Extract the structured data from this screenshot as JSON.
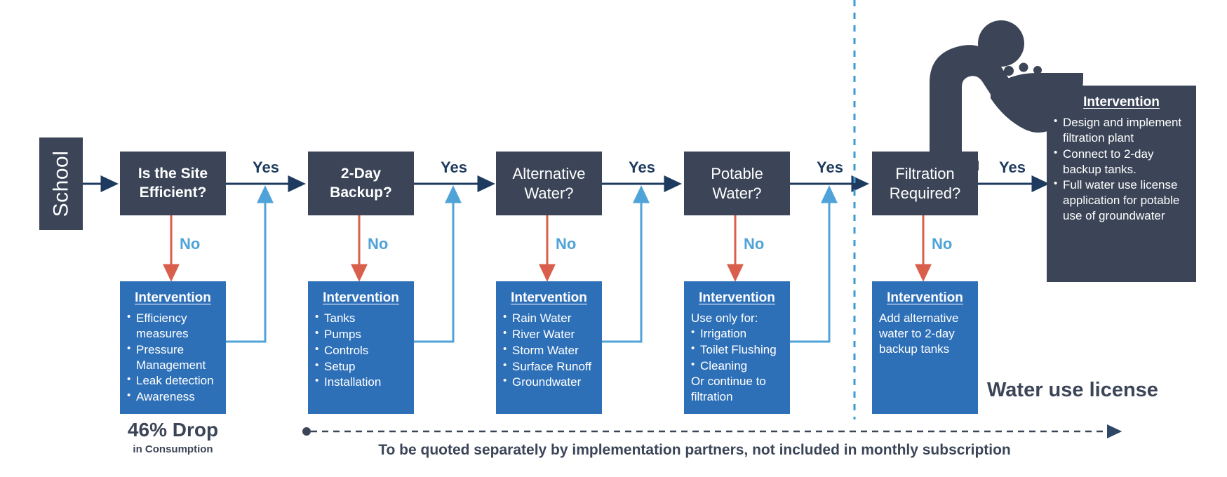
{
  "colors": {
    "dark": "#3B4557",
    "blue": "#2E70B8",
    "light_blue": "#4FA3D9",
    "red": "#D95F4C",
    "navy": "#1E3A5F",
    "white": "#FFFFFF"
  },
  "start": {
    "label": "School"
  },
  "labels": {
    "yes": "Yes",
    "no": "No",
    "intervention": "Intervention"
  },
  "decisions": [
    {
      "id": "site-efficient",
      "line1": "Is the Site",
      "line2": "Efficient?",
      "bold": true
    },
    {
      "id": "two-day-backup",
      "line1": "2-Day",
      "line2": "Backup?",
      "bold": true
    },
    {
      "id": "alternative-water",
      "line1": "Alternative",
      "line2": "Water?",
      "bold": false
    },
    {
      "id": "potable-water",
      "line1": "Potable",
      "line2": "Water?",
      "bold": false
    },
    {
      "id": "filtration-required",
      "line1": "Filtration",
      "line2": "Required?",
      "bold": false
    }
  ],
  "interventions": [
    {
      "id": "efficiency",
      "title": "Intervention",
      "lead": "",
      "items": [
        "Efficiency measures",
        "Pressure Management",
        "Leak detection",
        "Awareness"
      ],
      "trail": ""
    },
    {
      "id": "backup",
      "title": "Intervention",
      "lead": "",
      "items": [
        "Tanks",
        "Pumps",
        "Controls",
        "Setup",
        "Installation"
      ],
      "trail": ""
    },
    {
      "id": "alternative",
      "title": "Intervention",
      "lead": "",
      "items": [
        "Rain Water",
        "River Water",
        "Storm Water",
        "Surface Runoff",
        "Groundwater"
      ],
      "trail": ""
    },
    {
      "id": "potable",
      "title": "Intervention",
      "lead": "Use only for:",
      "items": [
        "Irrigation",
        "Toilet Flushing",
        "Cleaning"
      ],
      "trail": "Or continue to filtration"
    },
    {
      "id": "filtration",
      "title": "Intervention",
      "lead": "Add alternative water to 2-day backup tanks",
      "items": [],
      "trail": ""
    }
  ],
  "final_intervention": {
    "id": "filtration-plant",
    "title": "Intervention",
    "items": [
      "Design and implement filtration plant",
      "Connect to 2-day backup tanks.",
      "Full water use license application for potable use of groundwater"
    ]
  },
  "footer": {
    "drop_value": "46% Drop",
    "drop_caption": "in Consumption",
    "quoted_note": "To be quoted separately by implementation partners, not included in monthly subscription",
    "license_label": "Water use license"
  },
  "icons": {
    "water_fountain": "drinking-fountain-icon",
    "divider": "dashed-divider-icon"
  }
}
